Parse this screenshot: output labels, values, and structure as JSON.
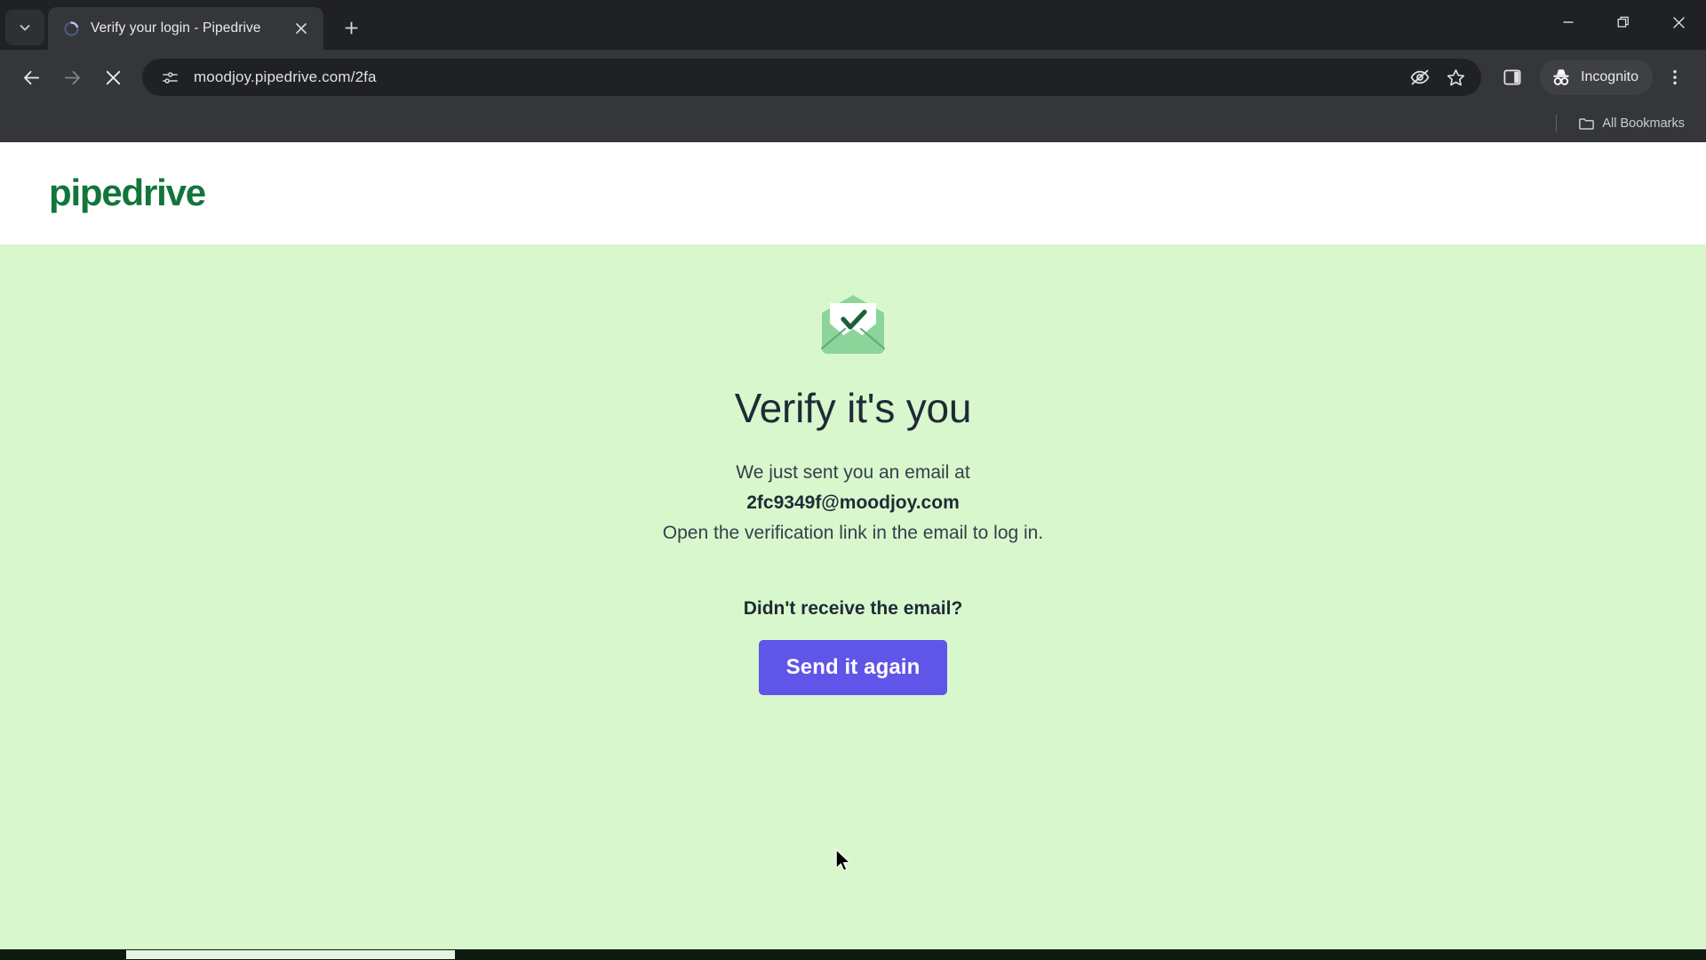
{
  "browser": {
    "tab": {
      "title": "Verify your login - Pipedrive",
      "favicon_icon": "loading-spinner-icon",
      "close_icon": "close-icon"
    },
    "tab_search_icon": "chevron-down-icon",
    "new_tab_icon": "plus-icon",
    "window_controls": {
      "minimize_icon": "minimize-icon",
      "maximize_icon": "restore-window-icon",
      "close_icon": "close-window-icon"
    },
    "nav": {
      "back_icon": "arrow-left-icon",
      "forward_icon": "arrow-right-icon",
      "stop_icon": "stop-loading-icon"
    },
    "omnibox": {
      "site_info_icon": "site-settings-icon",
      "url": "moodjoy.pipedrive.com/2fa",
      "tracking_protection_icon": "eye-off-icon",
      "bookmark_icon": "star-icon"
    },
    "side_panel_icon": "side-panel-icon",
    "profile": {
      "label": "Incognito",
      "icon": "incognito-icon"
    },
    "menu_icon": "three-dot-menu-icon",
    "bookmarks_bar": {
      "folder_icon": "folder-icon",
      "all_bookmarks_label": "All Bookmarks"
    }
  },
  "page": {
    "logo_text": "pipedrive",
    "logo_color": "#12753a",
    "background_color": "#d9f7cd",
    "header_background": "#ffffff",
    "illustration_icon": "envelope-check-icon",
    "headline": "Verify it's you",
    "body_line_1": "We just sent you an email at",
    "email": "2fc9349f@moodjoy.com",
    "body_line_2": "Open the verification link in the email to log in.",
    "prompt": "Didn't receive the email?",
    "resend_button_label": "Send it again",
    "resend_button_color": "#5f55e8"
  }
}
